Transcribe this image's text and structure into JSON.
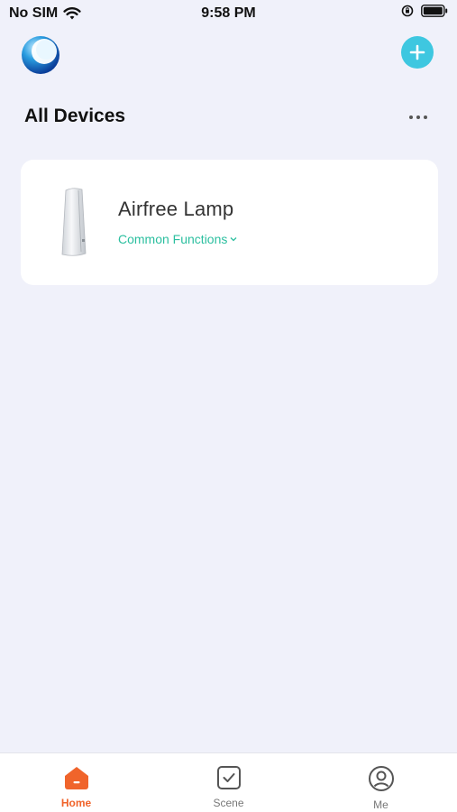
{
  "status_bar": {
    "carrier": "No SIM",
    "time": "9:58 PM"
  },
  "header": {
    "title": "All Devices",
    "logo_icon": "app-logo-icon",
    "add_icon": "plus-icon",
    "more_icon": "more-horizontal-icon"
  },
  "devices": [
    {
      "name": "Airfree Lamp",
      "functions_label": "Common Functions",
      "functions_icon": "chevron-down-icon"
    }
  ],
  "tabs": [
    {
      "label": "Home",
      "icon": "home-icon",
      "active": true
    },
    {
      "label": "Scene",
      "icon": "checkbox-icon",
      "active": false
    },
    {
      "label": "Me",
      "icon": "user-icon",
      "active": false
    }
  ],
  "colors": {
    "background": "#f0f1fa",
    "accent_add": "#3ec7e0",
    "functions_text": "#2bbf9f",
    "active_tab": "#f0642b",
    "inactive_tab": "#777777"
  }
}
